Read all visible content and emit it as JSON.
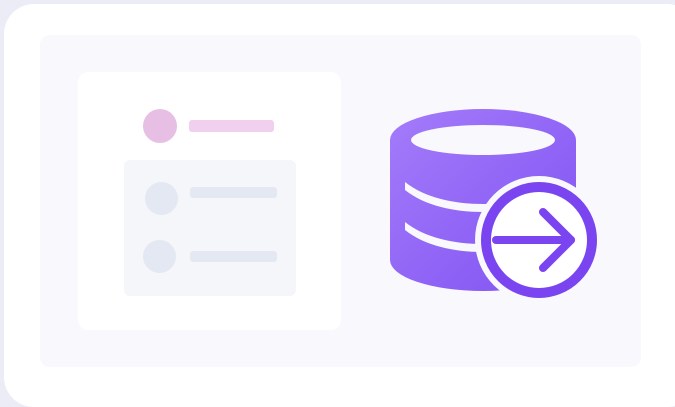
{
  "illustration": {
    "icon": "database-export-icon",
    "colors": {
      "page_background": "#ececf6",
      "frame": "#ffffff",
      "panel": "#f8f8fd",
      "accent": "#8a5cf6",
      "accent_dark": "#6d3bea",
      "header_avatar": "#e7bfe4",
      "placeholder": "#e3e8f2"
    },
    "list": {
      "header_placeholders": 1,
      "row_placeholders": 2
    }
  }
}
